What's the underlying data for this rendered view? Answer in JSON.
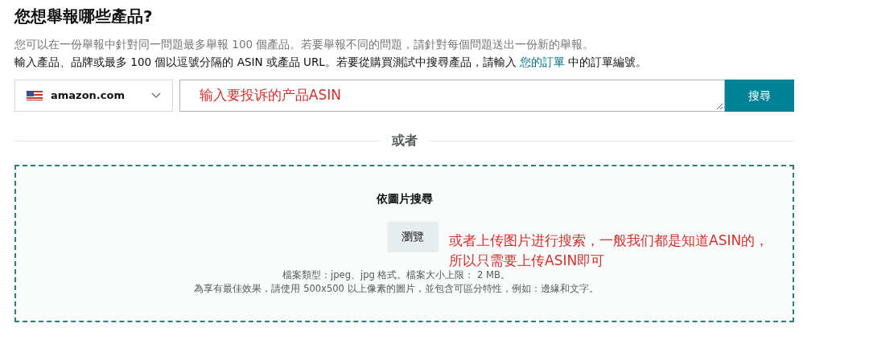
{
  "title": "您想舉報哪些產品?",
  "intro": "您可以在一份舉報中針對同一問題最多舉報 100 個產品。若要舉報不同的問題，請針對每個問題送出一份新的舉報。",
  "instructions": {
    "before": "輸入產品、品牌或最多 100 個以逗號分隔的 ASIN 或產品 URL。若要從購買測試中搜尋產品，請輸入",
    "link": "您的訂單",
    "after": "中的訂單編號。"
  },
  "search": {
    "marketplace": "amazon.com",
    "value": "输入要投诉的产品ASIN",
    "button": "搜尋"
  },
  "divider": "或者",
  "image_search": {
    "title": "依圖片搜尋",
    "button": "瀏覽",
    "file_types": "檔案類型：jpeg、jpg 格式。檔案大小上限： 2 MB。",
    "tip": "為享有最佳效果，請使用 500x500 以上像素的圖片，並包含可區分特性，例如：邊緣和文字。"
  },
  "annotation": [
    "或者上传图片进行搜索，一般我们都是知道ASIN的，",
    "所以只需要上传ASIN即可"
  ]
}
